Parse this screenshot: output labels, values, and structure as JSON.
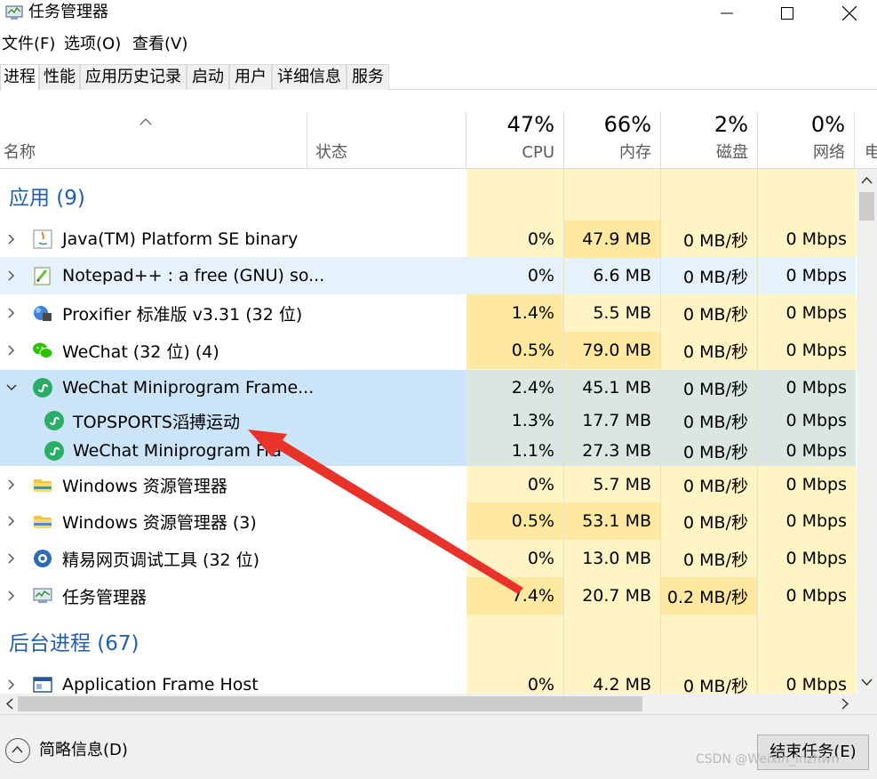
{
  "window": {
    "title": "任务管理器"
  },
  "menu": [
    "文件(F)",
    "选项(O)",
    "查看(V)"
  ],
  "tabs": [
    {
      "label": "进程",
      "active": true
    },
    {
      "label": "性能"
    },
    {
      "label": "应用历史记录"
    },
    {
      "label": "启动"
    },
    {
      "label": "用户"
    },
    {
      "label": "详细信息"
    },
    {
      "label": "服务"
    }
  ],
  "header": {
    "name": "名称",
    "status": "状态",
    "cpu_pct": "47%",
    "cpu": "CPU",
    "mem_pct": "66%",
    "mem": "内存",
    "disk_pct": "2%",
    "disk": "磁盘",
    "net_pct": "0%",
    "net": "网络",
    "power": "电"
  },
  "groups": {
    "apps": "应用 (9)",
    "background": "后台进程 (67)"
  },
  "rows": [
    {
      "name": "Java(TM) Platform SE binary",
      "cpu": "0%",
      "mem": "47.9 MB",
      "disk": "0 MB/秒",
      "net": "0 Mbps",
      "icon": "java-icon"
    },
    {
      "name": "Notepad++ : a free (GNU) so...",
      "cpu": "0%",
      "mem": "6.6 MB",
      "disk": "0 MB/秒",
      "net": "0 Mbps",
      "icon": "notepadpp-icon"
    },
    {
      "name": "Proxifier 标准版 v3.31 (32 位)",
      "cpu": "1.4%",
      "mem": "5.5 MB",
      "disk": "0 MB/秒",
      "net": "0 Mbps",
      "icon": "proxifier-icon"
    },
    {
      "name": "WeChat (32 位) (4)",
      "cpu": "0.5%",
      "mem": "79.0 MB",
      "disk": "0 MB/秒",
      "net": "0 Mbps",
      "icon": "wechat-icon"
    },
    {
      "name": "WeChat Miniprogram Frame...",
      "cpu": "2.4%",
      "mem": "45.1 MB",
      "disk": "0 MB/秒",
      "net": "0 Mbps",
      "icon": "miniprogram-icon"
    },
    {
      "name": "TOPSPORTS滔搏运动",
      "cpu": "1.3%",
      "mem": "17.7 MB",
      "disk": "0 MB/秒",
      "net": "0 Mbps",
      "icon": "miniprogram-icon"
    },
    {
      "name": "WeChat Miniprogram Fra",
      "cpu": "1.1%",
      "mem": "27.3 MB",
      "disk": "0 MB/秒",
      "net": "0 Mbps",
      "icon": "miniprogram-icon"
    },
    {
      "name": "Windows 资源管理器",
      "cpu": "0%",
      "mem": "5.7 MB",
      "disk": "0 MB/秒",
      "net": "0 Mbps",
      "icon": "folder-icon"
    },
    {
      "name": "Windows 资源管理器 (3)",
      "cpu": "0.5%",
      "mem": "53.1 MB",
      "disk": "0 MB/秒",
      "net": "0 Mbps",
      "icon": "folder-icon"
    },
    {
      "name": "精易网页调试工具 (32 位)",
      "cpu": "0%",
      "mem": "13.0 MB",
      "disk": "0 MB/秒",
      "net": "0 Mbps",
      "icon": "debug-tool-icon"
    },
    {
      "name": "任务管理器",
      "cpu": "7.4%",
      "mem": "20.7 MB",
      "disk": "0.2 MB/秒",
      "net": "0 Mbps",
      "icon": "task-manager-icon"
    },
    {
      "name": "Application Frame Host",
      "cpu": "0%",
      "mem": "4.2 MB",
      "disk": "0 MB/秒",
      "net": "0 Mbps",
      "icon": "app-frame-icon"
    }
  ],
  "footer": {
    "fewer_details": "简略信息(D)",
    "end_task": "结束任务(E)"
  },
  "watermark": "CSDN @Weixin_lnzhwn",
  "colors": {
    "heat_low": "#fff4c4",
    "heat_mid": "#ffe8a0",
    "selected": "#cce4f7",
    "hover": "#e5f1fb",
    "group": "#1f5fae",
    "arrow": "#e8322a"
  }
}
